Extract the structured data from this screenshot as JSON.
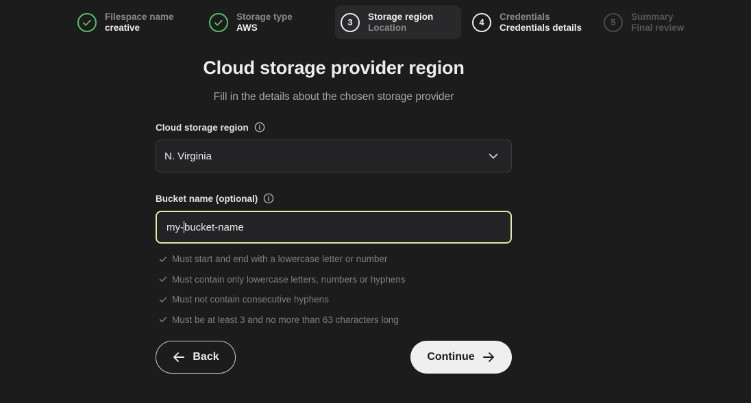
{
  "stepper": {
    "steps": [
      {
        "state": "done",
        "badge": "",
        "label": "Filespace name",
        "value": "creative",
        "icon": "check-icon"
      },
      {
        "state": "done",
        "badge": "",
        "label": "Storage type",
        "value": "AWS",
        "icon": "check-icon"
      },
      {
        "state": "current",
        "badge": "3",
        "label": "Storage region",
        "value": "Location"
      },
      {
        "state": "upcoming",
        "badge": "4",
        "label": "Credentials",
        "value": "Credentials details"
      },
      {
        "state": "disabled",
        "badge": "5",
        "label": "Summary",
        "value": "Final review"
      }
    ]
  },
  "main": {
    "title": "Cloud storage provider region",
    "subtitle": "Fill in the details about the chosen storage provider",
    "region": {
      "label": "Cloud storage region",
      "selected": "N. Virginia",
      "icon": "chevron-down-icon"
    },
    "bucket": {
      "label": "Bucket name (optional)",
      "value_before_caret": "my-",
      "value_after_caret": "bucket-name"
    },
    "rules": [
      "Must start and end with a lowercase letter or number",
      "Must contain only lowercase letters, numbers or hyphens",
      "Must not contain consecutive hyphens",
      "Must be at least 3 and no more than 63 characters long"
    ],
    "back_label": "Back",
    "continue_label": "Continue"
  },
  "colors": {
    "background": "#1c1c1d",
    "success": "#57c06b",
    "focus_border": "#d7f0a4",
    "muted_text": "#7f7f83"
  }
}
